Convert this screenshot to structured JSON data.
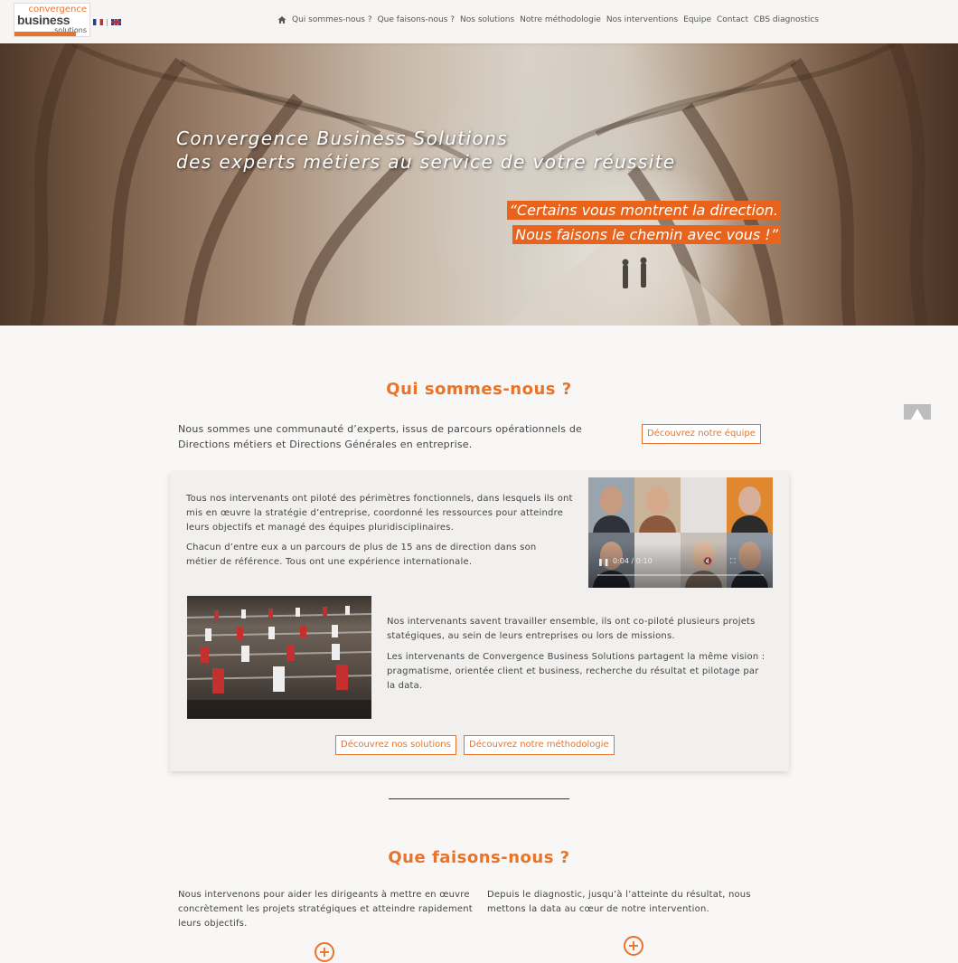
{
  "brand": {
    "logo_top": "convergence",
    "logo_main": "business",
    "logo_bottom": "solutions",
    "accent_color": "#e8732a"
  },
  "nav": {
    "languages": [
      "FR",
      "EN"
    ],
    "home_icon": "home-icon",
    "items": [
      "Qui sommes-nous ?",
      "Que faisons-nous ?",
      "Nos solutions",
      "Notre méthodologie",
      "Nos interventions",
      "Equipe",
      "Contact",
      "CBS diagnostics"
    ]
  },
  "hero": {
    "title_line1": "Convergence Business Solutions",
    "title_line2": "des experts métiers au service de votre réussite",
    "quote_line1": "“Certains vous montrent la direction.",
    "quote_line2": "Nous faisons le chemin avec vous !”"
  },
  "about": {
    "heading": "Qui sommes-nous ?",
    "intro": "Nous sommes une communauté d’experts, issus de parcours opérationnels de Directions métiers et Directions Générales en entreprise.",
    "team_button": "Découvrez notre équipe",
    "card_p1": "Tous nos intervenants ont piloté des périmètres fonctionnels, dans lesquels ils ont mis en œuvre la stratégie d’entreprise, coordonné les ressources pour atteindre leurs objectifs et managé des équipes pluridisciplinaires.",
    "card_p2": "Chacun d’entre eux a un parcours de plus de 15 ans de direction dans son métier de référence. Tous ont une expérience internationale.",
    "card_p3": "Nos intervenants savent travailler ensemble, ils ont co-piloté plusieurs projets statégiques, au sein de leurs entreprises ou lors de missions.",
    "card_p4": "Les intervenants de Convergence Business Solutions partagent la même vision : pragmatisme, orientée client et business, recherche du résultat et pilotage par la data.",
    "video_time": "0:04 / 0:10",
    "solutions_button": "Découvrez nos solutions",
    "method_button": "Découvrez notre méthodologie"
  },
  "what": {
    "heading": "Que faisons-nous ?",
    "col1": "Nous intervenons pour aider les dirigeants à mettre en œuvre concrètement les projets stratégiques et atteindre rapidement leurs objectifs.",
    "col2": "Depuis le diagnostic, jusqu’à l’atteinte du résultat, nous mettons la data au cœur de notre intervention.",
    "expand_symbol": "+"
  }
}
